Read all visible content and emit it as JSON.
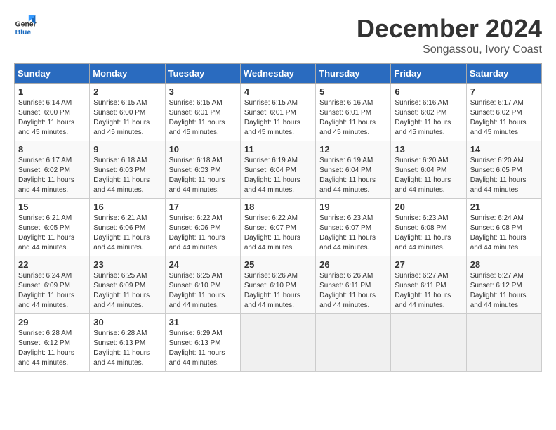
{
  "header": {
    "logo_line1": "General",
    "logo_line2": "Blue",
    "month": "December 2024",
    "location": "Songassou, Ivory Coast"
  },
  "days_of_week": [
    "Sunday",
    "Monday",
    "Tuesday",
    "Wednesday",
    "Thursday",
    "Friday",
    "Saturday"
  ],
  "weeks": [
    [
      {
        "num": "1",
        "sunrise": "6:14 AM",
        "sunset": "6:00 PM",
        "daylight": "11 hours and 45 minutes."
      },
      {
        "num": "2",
        "sunrise": "6:15 AM",
        "sunset": "6:00 PM",
        "daylight": "11 hours and 45 minutes."
      },
      {
        "num": "3",
        "sunrise": "6:15 AM",
        "sunset": "6:01 PM",
        "daylight": "11 hours and 45 minutes."
      },
      {
        "num": "4",
        "sunrise": "6:15 AM",
        "sunset": "6:01 PM",
        "daylight": "11 hours and 45 minutes."
      },
      {
        "num": "5",
        "sunrise": "6:16 AM",
        "sunset": "6:01 PM",
        "daylight": "11 hours and 45 minutes."
      },
      {
        "num": "6",
        "sunrise": "6:16 AM",
        "sunset": "6:02 PM",
        "daylight": "11 hours and 45 minutes."
      },
      {
        "num": "7",
        "sunrise": "6:17 AM",
        "sunset": "6:02 PM",
        "daylight": "11 hours and 45 minutes."
      }
    ],
    [
      {
        "num": "8",
        "sunrise": "6:17 AM",
        "sunset": "6:02 PM",
        "daylight": "11 hours and 44 minutes."
      },
      {
        "num": "9",
        "sunrise": "6:18 AM",
        "sunset": "6:03 PM",
        "daylight": "11 hours and 44 minutes."
      },
      {
        "num": "10",
        "sunrise": "6:18 AM",
        "sunset": "6:03 PM",
        "daylight": "11 hours and 44 minutes."
      },
      {
        "num": "11",
        "sunrise": "6:19 AM",
        "sunset": "6:04 PM",
        "daylight": "11 hours and 44 minutes."
      },
      {
        "num": "12",
        "sunrise": "6:19 AM",
        "sunset": "6:04 PM",
        "daylight": "11 hours and 44 minutes."
      },
      {
        "num": "13",
        "sunrise": "6:20 AM",
        "sunset": "6:04 PM",
        "daylight": "11 hours and 44 minutes."
      },
      {
        "num": "14",
        "sunrise": "6:20 AM",
        "sunset": "6:05 PM",
        "daylight": "11 hours and 44 minutes."
      }
    ],
    [
      {
        "num": "15",
        "sunrise": "6:21 AM",
        "sunset": "6:05 PM",
        "daylight": "11 hours and 44 minutes."
      },
      {
        "num": "16",
        "sunrise": "6:21 AM",
        "sunset": "6:06 PM",
        "daylight": "11 hours and 44 minutes."
      },
      {
        "num": "17",
        "sunrise": "6:22 AM",
        "sunset": "6:06 PM",
        "daylight": "11 hours and 44 minutes."
      },
      {
        "num": "18",
        "sunrise": "6:22 AM",
        "sunset": "6:07 PM",
        "daylight": "11 hours and 44 minutes."
      },
      {
        "num": "19",
        "sunrise": "6:23 AM",
        "sunset": "6:07 PM",
        "daylight": "11 hours and 44 minutes."
      },
      {
        "num": "20",
        "sunrise": "6:23 AM",
        "sunset": "6:08 PM",
        "daylight": "11 hours and 44 minutes."
      },
      {
        "num": "21",
        "sunrise": "6:24 AM",
        "sunset": "6:08 PM",
        "daylight": "11 hours and 44 minutes."
      }
    ],
    [
      {
        "num": "22",
        "sunrise": "6:24 AM",
        "sunset": "6:09 PM",
        "daylight": "11 hours and 44 minutes."
      },
      {
        "num": "23",
        "sunrise": "6:25 AM",
        "sunset": "6:09 PM",
        "daylight": "11 hours and 44 minutes."
      },
      {
        "num": "24",
        "sunrise": "6:25 AM",
        "sunset": "6:10 PM",
        "daylight": "11 hours and 44 minutes."
      },
      {
        "num": "25",
        "sunrise": "6:26 AM",
        "sunset": "6:10 PM",
        "daylight": "11 hours and 44 minutes."
      },
      {
        "num": "26",
        "sunrise": "6:26 AM",
        "sunset": "6:11 PM",
        "daylight": "11 hours and 44 minutes."
      },
      {
        "num": "27",
        "sunrise": "6:27 AM",
        "sunset": "6:11 PM",
        "daylight": "11 hours and 44 minutes."
      },
      {
        "num": "28",
        "sunrise": "6:27 AM",
        "sunset": "6:12 PM",
        "daylight": "11 hours and 44 minutes."
      }
    ],
    [
      {
        "num": "29",
        "sunrise": "6:28 AM",
        "sunset": "6:12 PM",
        "daylight": "11 hours and 44 minutes."
      },
      {
        "num": "30",
        "sunrise": "6:28 AM",
        "sunset": "6:13 PM",
        "daylight": "11 hours and 44 minutes."
      },
      {
        "num": "31",
        "sunrise": "6:29 AM",
        "sunset": "6:13 PM",
        "daylight": "11 hours and 44 minutes."
      },
      null,
      null,
      null,
      null
    ]
  ]
}
